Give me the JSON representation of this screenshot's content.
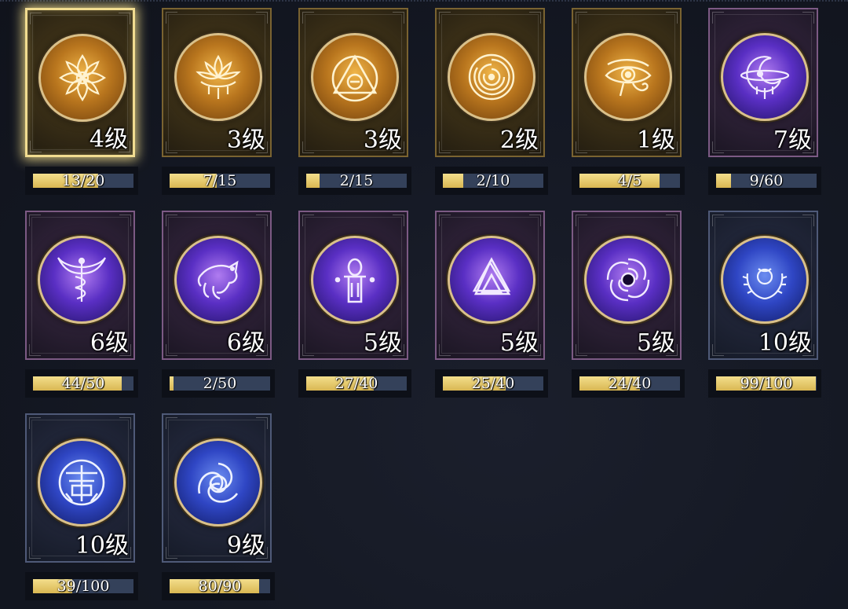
{
  "cards": [
    {
      "icon": "lotus-flower-icon",
      "rarity": "gold",
      "level": "4级",
      "progress_text": "13/20",
      "current": 13,
      "max": 20,
      "selected": true
    },
    {
      "icon": "lotus-chandelier-icon",
      "rarity": "gold",
      "level": "3级",
      "progress_text": "7/15",
      "current": 7,
      "max": 15,
      "selected": false
    },
    {
      "icon": "triangle-circle-icon",
      "rarity": "gold",
      "level": "3级",
      "progress_text": "2/15",
      "current": 2,
      "max": 15,
      "selected": false
    },
    {
      "icon": "labyrinth-icon",
      "rarity": "gold",
      "level": "2级",
      "progress_text": "2/10",
      "current": 2,
      "max": 10,
      "selected": false
    },
    {
      "icon": "eye-of-horus-icon",
      "rarity": "gold",
      "level": "1级",
      "progress_text": "4/5",
      "current": 4,
      "max": 5,
      "selected": false
    },
    {
      "icon": "crescent-moon-icon",
      "rarity": "purple",
      "level": "7级",
      "progress_text": "9/60",
      "current": 9,
      "max": 60,
      "selected": false
    },
    {
      "icon": "caduceus-icon",
      "rarity": "purple",
      "level": "6级",
      "progress_text": "44/50",
      "current": 44,
      "max": 50,
      "selected": false
    },
    {
      "icon": "horse-icon",
      "rarity": "purple",
      "level": "6级",
      "progress_text": "2/50",
      "current": 2,
      "max": 50,
      "selected": false
    },
    {
      "icon": "ankh-icon",
      "rarity": "purple",
      "level": "5级",
      "progress_text": "27/40",
      "current": 27,
      "max": 40,
      "selected": false
    },
    {
      "icon": "valknut-icon",
      "rarity": "purple",
      "level": "5级",
      "progress_text": "25/40",
      "current": 25,
      "max": 40,
      "selected": false
    },
    {
      "icon": "vortex-icon",
      "rarity": "purple",
      "level": "5级",
      "progress_text": "24/40",
      "current": 24,
      "max": 40,
      "selected": false
    },
    {
      "icon": "laurel-moon-icon",
      "rarity": "blue",
      "level": "10级",
      "progress_text": "99/100",
      "current": 99,
      "max": 100,
      "selected": false
    },
    {
      "icon": "shou-symbol-icon",
      "rarity": "blue",
      "level": "10级",
      "progress_text": "39/100",
      "current": 39,
      "max": 100,
      "selected": false
    },
    {
      "icon": "triple-horn-knot-icon",
      "rarity": "blue",
      "level": "9级",
      "progress_text": "80/90",
      "current": 80,
      "max": 90,
      "selected": false
    }
  ],
  "colors": {
    "gold_border": "#7a6331",
    "purple_border": "#7c5a84",
    "blue_border": "#4f5a78",
    "progress_fill": "#e6c767",
    "progress_track": "#34415a",
    "selected_glow": "#f1dc90"
  }
}
